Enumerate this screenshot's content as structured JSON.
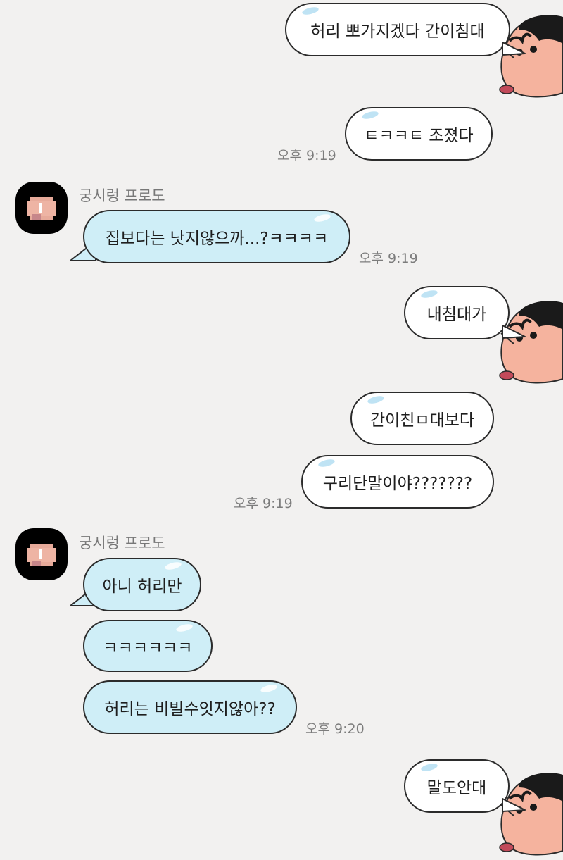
{
  "chat": {
    "m1": "허리 뽀가지겠다 간이침대",
    "m2": "ㅌㅋㅋㅌ 조졌다",
    "t1": "오후 9:19",
    "sender": "궁시렁 프로도",
    "m3": "집보다는 낫지않으까...?ㅋㅋㅋㅋ",
    "t2": "오후 9:19",
    "m4": "내침대가",
    "m5": "간이친ㅁ대보다",
    "m6": "구리단말이야???????",
    "t3": "오후 9:19",
    "sender2": "궁시렁 프로도",
    "m7": "아니 허리만",
    "m8": "ㅋㅋㅋㅋㅋㅋ",
    "m9": "허리는 비빌수잇지않아??",
    "t4": "오후 9:20",
    "m10": "말도안대"
  },
  "icons": {
    "profile": "pixelated-profile-avatar",
    "sticker": "crayon-shin-chan-face"
  },
  "colors": {
    "background": "#f2f1f0",
    "incoming_bubble": "#cfeef7",
    "outgoing_bubble": "#ffffff",
    "border": "#2b2b2b"
  }
}
